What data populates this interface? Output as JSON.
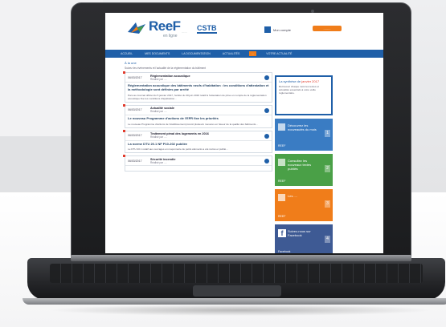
{
  "site": {
    "logo_text": "ReeF",
    "logo_sub": "en ligne",
    "logo_sep": "......",
    "partner": "CSTB",
    "user_label": "Mon compte",
    "login_label": "........"
  },
  "nav": {
    "items": [
      "ACCUEIL",
      "MES DOCUMENTS",
      "LA DOCUMENTATION",
      "ACTUALITÉS",
      "...",
      "VOTRE ACTUALITÉ"
    ],
    "active_index": 4
  },
  "main": {
    "breadcrumb": "À la une",
    "page_title": "",
    "intro": "Suivez les événements et l'actualité de la réglementation du bâtiment",
    "cards": [
      {
        "date": "06/03/2017",
        "category": "Réglementation acoustique",
        "subtitle": "Réalisé par ....",
        "title": "Réglementation acoustique des bâtiments neufs d'habitation : les conditions d'attestation et la méthodologie sont définies par arrêté",
        "text": "Paru au Journal officiel du 5 janvier 2017, l'arrêté du 30 juin 2016 relatif à l'attestation de prise en compte de la réglementation acoustique fixe les conditions d'application..."
      },
      {
        "date": "06/03/2017",
        "category": "Actualité sociale",
        "subtitle": "Réalisé par ....",
        "title": "Le nouveau Programme d'actions de l'EFR fixe les priorités",
        "text": "Le nouveau Programme d'actions de l'établissement prévoit plusieurs mesures en faveur de la qualité des bâtiments..."
      },
      {
        "date": "06/03/2017",
        "category": "Traitement pénal des logements en 2016",
        "subtitle": "Réalisé par ....",
        "title": "La norme DTU 20.1 NF P10-202 publiée",
        "text": "Le DTU 20.1 relatif aux ouvrages en maçonnerie de petits éléments a été révisé et publié..."
      },
      {
        "date": "06/03/2017",
        "category": "Sécurité incendie",
        "subtitle": "Réalisé par ....",
        "title": "",
        "text": ""
      }
    ]
  },
  "sidebar": {
    "synth_title_prefix": "La synthèse de ",
    "synth_title_highlight": "janvier 2017",
    "synth_text": "Retrouvez chaque mois les textes et actualités essentiels à votre veille réglementaire.",
    "tiles": [
      {
        "label": "Découvrez les nouveautés du mois",
        "foot": "REEF",
        "num": "1"
      },
      {
        "label": "Consultez les nouveaux textes publiés",
        "foot": "REEF",
        "num": "2"
      },
      {
        "label": "Les ....",
        "foot": "REEF",
        "num": "3"
      },
      {
        "label": "Suivez-nous sur Facebook",
        "foot": "Facebook",
        "num": "4"
      }
    ]
  },
  "colors": {
    "brand_blue": "#1f5fa8",
    "accent_orange": "#f07d1a",
    "green": "#4aa047",
    "facebook": "#3e5a94"
  }
}
